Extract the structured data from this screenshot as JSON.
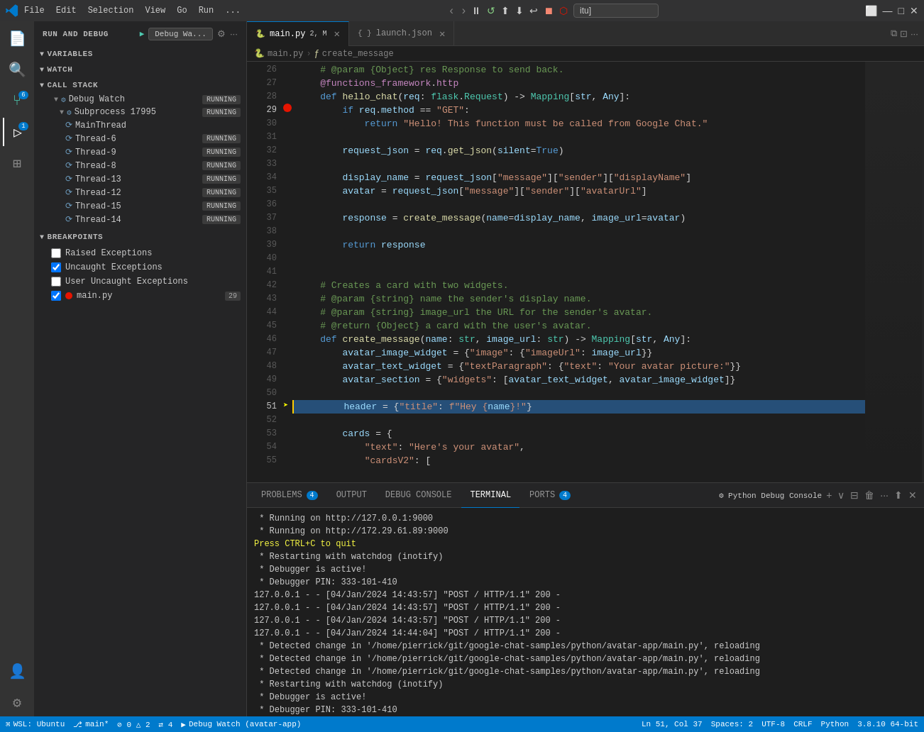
{
  "titlebar": {
    "menu_items": [
      "File",
      "Edit",
      "Selection",
      "View",
      "Go",
      "Run",
      "..."
    ],
    "address": "itu]",
    "debug_controls": [
      "⏸",
      "↺",
      "⬆",
      "⬇",
      "↩",
      "⏹",
      "🔴"
    ],
    "window_controls": [
      "🗖",
      "⬜",
      "❌"
    ]
  },
  "sidebar": {
    "title": "RUN AND DEBUG",
    "config_name": "Debug Wa...",
    "variables_label": "VARIABLES",
    "watch_label": "WATCH",
    "callstack_label": "CALL STACK",
    "breakpoints_label": "BREAKPOINTS",
    "callstack_items": [
      {
        "name": "Debug Watch",
        "level": 1,
        "status": "RUNNING",
        "has_expand": true
      },
      {
        "name": "Subprocess 17995",
        "level": 2,
        "status": "RUNNING",
        "has_expand": true
      },
      {
        "name": "MainThread",
        "level": 3,
        "status": ""
      },
      {
        "name": "Thread-6",
        "level": 3,
        "status": "RUNNING"
      },
      {
        "name": "Thread-9",
        "level": 3,
        "status": "RUNNING"
      },
      {
        "name": "Thread-8",
        "level": 3,
        "status": "RUNNING"
      },
      {
        "name": "Thread-13",
        "level": 3,
        "status": "RUNNING"
      },
      {
        "name": "Thread-12",
        "level": 3,
        "status": "RUNNING"
      },
      {
        "name": "Thread-15",
        "level": 3,
        "status": "RUNNING"
      },
      {
        "name": "Thread-14",
        "level": 3,
        "status": "RUNNING"
      }
    ],
    "breakpoints": [
      {
        "name": "Raised Exceptions",
        "checked": false,
        "has_dot": false
      },
      {
        "name": "Uncaught Exceptions",
        "checked": true,
        "has_dot": false
      },
      {
        "name": "User Uncaught Exceptions",
        "checked": false,
        "has_dot": false
      },
      {
        "name": "main.py",
        "checked": true,
        "has_dot": true,
        "count": "29"
      }
    ]
  },
  "editor": {
    "tabs": [
      {
        "name": "main.py",
        "label": "main.py",
        "suffix": "2, M",
        "active": true,
        "modified": true
      },
      {
        "name": "launch.json",
        "label": "launch.json",
        "active": false
      }
    ],
    "breadcrumb": [
      "main.py",
      "create_message"
    ],
    "lines": [
      {
        "no": 26,
        "content": "    # @param {Object} res Response to send back.",
        "type": "comment"
      },
      {
        "no": 27,
        "content": "    @functions_framework.http",
        "type": "decorator"
      },
      {
        "no": 28,
        "content": "    def hello_chat(req: flask.Request) -> Mapping[str, Any]:",
        "type": "code"
      },
      {
        "no": 29,
        "content": "        if req.method == \"GET\":",
        "type": "code",
        "breakpoint": true
      },
      {
        "no": 30,
        "content": "            return \"Hello! This function must be called from Google Chat.\"",
        "type": "code"
      },
      {
        "no": 31,
        "content": "",
        "type": "empty"
      },
      {
        "no": 32,
        "content": "        request_json = req.get_json(silent=True)",
        "type": "code"
      },
      {
        "no": 33,
        "content": "",
        "type": "empty"
      },
      {
        "no": 34,
        "content": "        display_name = request_json[\"message\"][\"sender\"][\"displayName\"]",
        "type": "code"
      },
      {
        "no": 35,
        "content": "        avatar = request_json[\"message\"][\"sender\"][\"avatarUrl\"]",
        "type": "code"
      },
      {
        "no": 36,
        "content": "",
        "type": "empty"
      },
      {
        "no": 37,
        "content": "        response = create_message(name=display_name, image_url=avatar)",
        "type": "code"
      },
      {
        "no": 38,
        "content": "",
        "type": "empty"
      },
      {
        "no": 39,
        "content": "        return response",
        "type": "code"
      },
      {
        "no": 40,
        "content": "",
        "type": "empty"
      },
      {
        "no": 41,
        "content": "",
        "type": "empty"
      },
      {
        "no": 42,
        "content": "    # Creates a card with two widgets.",
        "type": "comment"
      },
      {
        "no": 43,
        "content": "    # @param {string} name the sender's display name.",
        "type": "comment"
      },
      {
        "no": 44,
        "content": "    # @param {string} image_url the URL for the sender's avatar.",
        "type": "comment"
      },
      {
        "no": 45,
        "content": "    # @return {Object} a card with the user's avatar.",
        "type": "comment"
      },
      {
        "no": 46,
        "content": "    def create_message(name: str, image_url: str) -> Mapping[str, Any]:",
        "type": "code"
      },
      {
        "no": 47,
        "content": "        avatar_image_widget = {\"image\": {\"imageUrl\": image_url}}",
        "type": "code"
      },
      {
        "no": 48,
        "content": "        avatar_text_widget = {\"textParagraph\": {\"text\": \"Your avatar picture:\"}}",
        "type": "code"
      },
      {
        "no": 49,
        "content": "        avatar_section = {\"widgets\": [avatar_text_widget, avatar_image_widget]}",
        "type": "code"
      },
      {
        "no": 50,
        "content": "",
        "type": "empty"
      },
      {
        "no": 51,
        "content": "        header = {\"title\": f\"Hey {name}!\"}",
        "type": "code",
        "debug": true
      },
      {
        "no": 52,
        "content": "",
        "type": "empty"
      },
      {
        "no": 53,
        "content": "        cards = {",
        "type": "code"
      },
      {
        "no": 54,
        "content": "            \"text\": \"Here's your avatar\",",
        "type": "code"
      },
      {
        "no": 55,
        "content": "            \"cardsV2\": [",
        "type": "code"
      }
    ]
  },
  "panel": {
    "tabs": [
      {
        "name": "PROBLEMS",
        "label": "PROBLEMS",
        "badge": "4"
      },
      {
        "name": "OUTPUT",
        "label": "OUTPUT",
        "badge": null
      },
      {
        "name": "DEBUG CONSOLE",
        "label": "DEBUG CONSOLE",
        "badge": null
      },
      {
        "name": "TERMINAL",
        "label": "TERMINAL",
        "active": true,
        "badge": null
      },
      {
        "name": "PORTS",
        "label": "PORTS",
        "badge": "4"
      }
    ],
    "active_tab_label": "Python Debug Console",
    "terminal_lines": [
      " * Running on http://127.0.0.1:9000",
      " * Running on http://172.29.61.89:9000",
      "Press CTRL+C to quit",
      " * Restarting with watchdog (inotify)",
      " * Debugger is active!",
      " * Debugger PIN: 333-101-410",
      "127.0.0.1 - - [04/Jan/2024 14:43:57] \"POST / HTTP/1.1\" 200 -",
      "127.0.0.1 - - [04/Jan/2024 14:43:57] \"POST / HTTP/1.1\" 200 -",
      "127.0.0.1 - - [04/Jan/2024 14:43:57] \"POST / HTTP/1.1\" 200 -",
      "127.0.0.1 - - [04/Jan/2024 14:44:04] \"POST / HTTP/1.1\" 200 -",
      " * Detected change in '/home/pierrick/git/google-chat-samples/python/avatar-app/main.py', reloading",
      " * Detected change in '/home/pierrick/git/google-chat-samples/python/avatar-app/main.py', reloading",
      " * Detected change in '/home/pierrick/git/google-chat-samples/python/avatar-app/main.py', reloading",
      " * Restarting with watchdog (inotify)",
      " * Debugger is active!",
      " * Debugger PIN: 333-101-410"
    ]
  },
  "statusbar": {
    "left": [
      "WSL: Ubuntu",
      "main*",
      "⊘ 0 △ 2",
      "⎇ 4",
      "Debug Watch (avatar-app)"
    ],
    "right": [
      "Ln 51, Col 37",
      "Spaces: 2",
      "UTF-8",
      "CRLF",
      "Python",
      "3.8.10 64-bit"
    ]
  }
}
